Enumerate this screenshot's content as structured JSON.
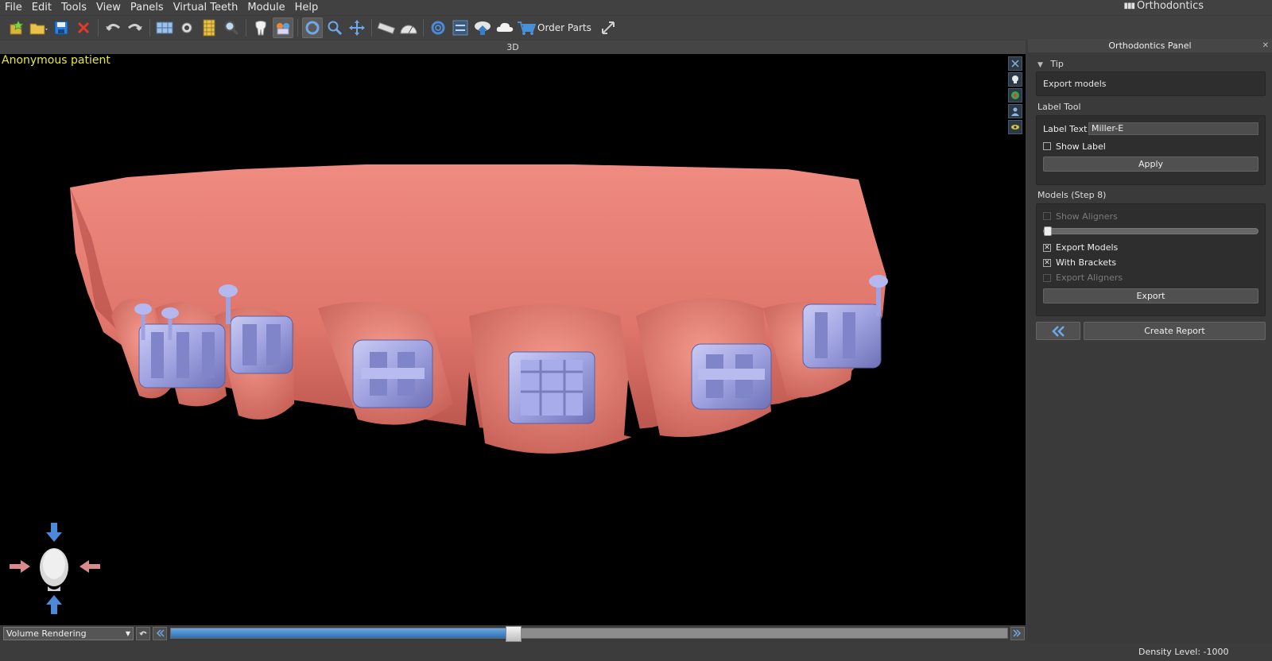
{
  "menu": [
    "File",
    "Edit",
    "Tools",
    "View",
    "Panels",
    "Virtual Teeth",
    "Module",
    "Help"
  ],
  "brand": {
    "name": "Orthodontics"
  },
  "toolbar": {
    "order_parts_label": "Order Parts",
    "icons": [
      "new-case-icon",
      "open-folder-icon",
      "save-icon",
      "close-case-icon",
      "undo-icon",
      "redo-icon",
      "layout-icon",
      "screenshot-icon",
      "ruler-grid-icon",
      "magnify-icon",
      "tooth-icon",
      "teeth-segment-icon",
      "rotate-icon",
      "zoom-icon",
      "pan-icon",
      "measure-distance-icon",
      "measure-angle-icon",
      "rotation-reset-icon",
      "align-icon",
      "upload-icon",
      "cloud-icon",
      "cart-icon",
      "fullscreen-icon"
    ]
  },
  "view": {
    "header": "3D",
    "patient": "Anonymous patient",
    "render_mode": "Volume Rendering"
  },
  "density": {
    "fraction": 0.41,
    "status_text": "Density Level: -1000"
  },
  "panel": {
    "title": "Orthodontics Panel",
    "tip": {
      "header": "Tip",
      "text": "Export models"
    },
    "label_tool": {
      "header": "Label Tool",
      "label_text_caption": "Label Text",
      "label_text_value": "Miller-E",
      "show_label": "Show Label",
      "apply": "Apply"
    },
    "models": {
      "header": "Models (Step 8)",
      "show_aligners": "Show Aligners",
      "export_models": "Export Models",
      "with_brackets": "With Brackets",
      "export_aligners": "Export Aligners",
      "export": "Export"
    },
    "create_report": "Create Report"
  },
  "colors": {
    "gum": "#e07a70",
    "bracket": "#9fa2e0",
    "accent_blue": "#3a7cc7",
    "patient_text": "#e8e83a"
  }
}
